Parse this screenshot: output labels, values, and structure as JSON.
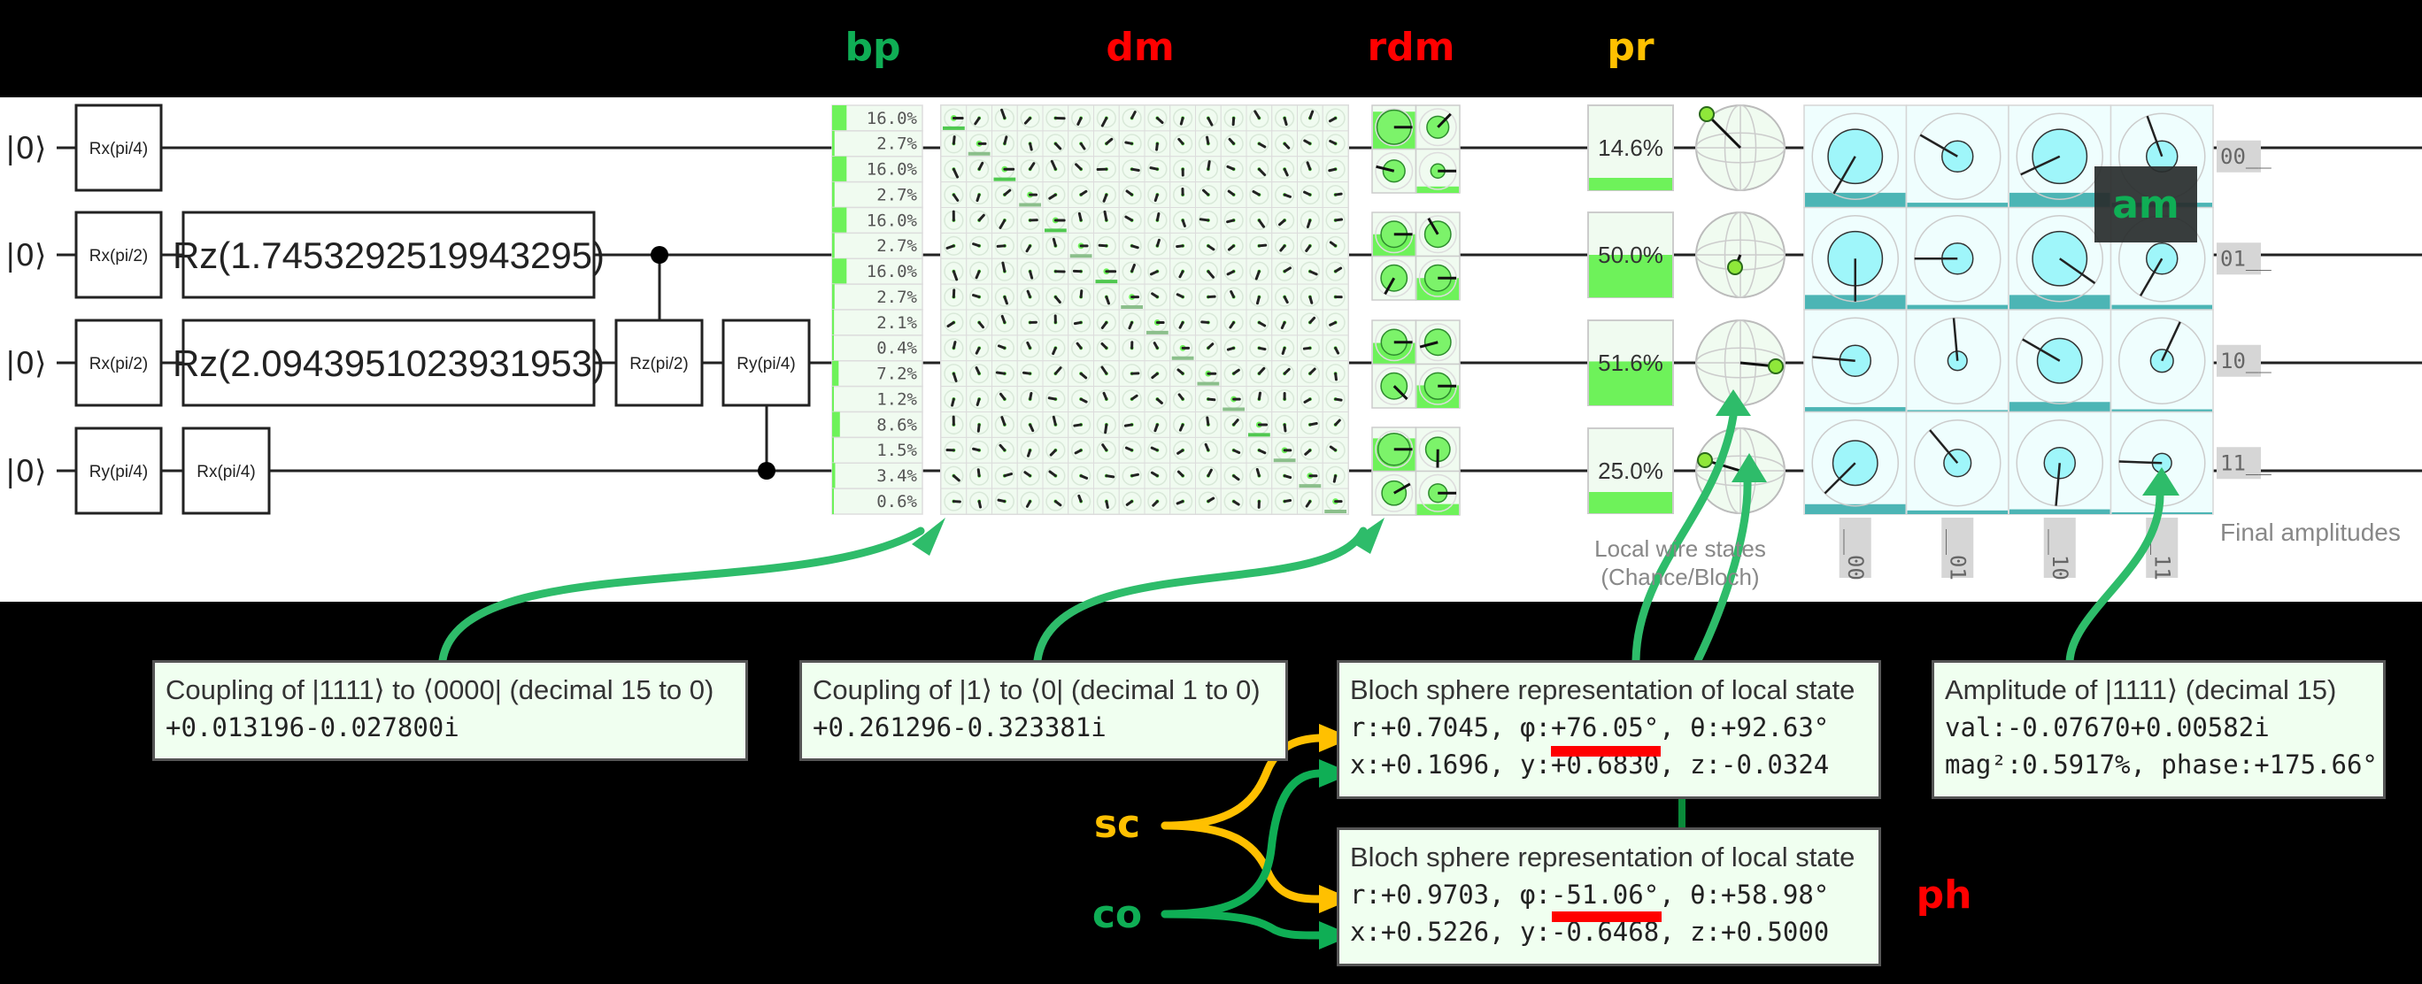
{
  "annotations": {
    "bp": "bp",
    "dm": "dm",
    "rdm": "rdm",
    "pr": "pr",
    "am": "am",
    "sc": "sc",
    "co": "co",
    "ph": "ph",
    "colors": {
      "green": "#0fae55",
      "red": "#ff0000",
      "orange": "#ffc000"
    }
  },
  "circuit": {
    "wires": [
      {
        "init": "|0⟩",
        "gates": [
          "Rx(pi/4)"
        ]
      },
      {
        "init": "|0⟩",
        "gates": [
          "Rx(pi/2)",
          "Rz(1.7453292519943295)"
        ]
      },
      {
        "init": "|0⟩",
        "gates": [
          "Rx(pi/2)",
          "Rz(2.0943951023931953)",
          "Rz(pi/2)",
          "Ry(pi/4)"
        ]
      },
      {
        "init": "|0⟩",
        "gates": [
          "Ry(pi/4)",
          "Rx(pi/4)"
        ]
      }
    ],
    "controlled_gates": [
      {
        "gate": "Rz(pi/2)",
        "target_wire": 2,
        "control_wire": 1
      },
      {
        "gate": "Ry(pi/4)",
        "target_wire": 2,
        "control_wire": 3
      }
    ]
  },
  "basis_probabilities": {
    "labels": [
      "16.0%",
      "2.7%",
      "16.0%",
      "2.7%",
      "16.0%",
      "2.7%",
      "16.0%",
      "2.7%",
      "2.1%",
      "0.4%",
      "7.2%",
      "1.2%",
      "8.6%",
      "1.5%",
      "3.4%",
      "0.6%"
    ],
    "values": [
      16.0,
      2.7,
      16.0,
      2.7,
      16.0,
      2.7,
      16.0,
      2.7,
      2.1,
      0.4,
      7.2,
      1.2,
      8.6,
      1.5,
      3.4,
      0.6
    ],
    "bar_color": "#6ef25a"
  },
  "density_matrix": {
    "size": 16,
    "diagonal": [
      16.0,
      2.7,
      16.0,
      2.7,
      16.0,
      2.7,
      16.0,
      2.7,
      2.1,
      0.4,
      7.2,
      1.2,
      8.6,
      1.5,
      3.4,
      0.6
    ]
  },
  "reduced_density_matrices": [
    {
      "diag": [
        0.854,
        0.146
      ]
    },
    {
      "diag": [
        0.5,
        0.5
      ]
    },
    {
      "diag": [
        0.484,
        0.516
      ]
    },
    {
      "diag": [
        0.75,
        0.25
      ]
    }
  ],
  "wire_probabilities": [
    {
      "label": "14.6%",
      "value": 14.6
    },
    {
      "label": "50.0%",
      "value": 50.0
    },
    {
      "label": "51.6%",
      "value": 51.6
    },
    {
      "label": "25.0%",
      "value": 25.0
    }
  ],
  "local_states_caption": [
    "Local wire states",
    "(Chance/Bloch)"
  ],
  "amplitudes": {
    "row_labels": [
      "00__",
      "01__",
      "10__",
      "11__"
    ],
    "col_labels": [
      "__00",
      "__01",
      "__10",
      "__11"
    ],
    "caption": "Final amplitudes"
  },
  "tooltips": {
    "coupling_15_0": {
      "title": "Coupling of |1111⟩ to ⟨0000| (decimal 15 to 0)",
      "value": "+0.013196-0.027800i"
    },
    "coupling_1_0": {
      "title": "Coupling of |1⟩ to ⟨0| (decimal 1 to 0)",
      "value": "+0.261296-0.323381i"
    },
    "bloch_a": {
      "title": "Bloch sphere representation of local state",
      "spherical": "r:+0.7045, φ:+76.05°, θ:+92.63°",
      "cartesian": "x:+0.1696, y:+0.6830, z:-0.0324"
    },
    "bloch_b": {
      "title": "Bloch sphere representation of local state",
      "spherical": "r:+0.9703, φ:-51.06°, θ:+58.98°",
      "cartesian": "x:+0.5226, y:-0.6468, z:+0.5000"
    },
    "amplitude_15": {
      "title": "Amplitude of |1111⟩ (decimal 15)",
      "value": "val:-0.07670+0.00582i",
      "mag_phase": "mag²:0.5917%, phase:+175.66°"
    }
  }
}
